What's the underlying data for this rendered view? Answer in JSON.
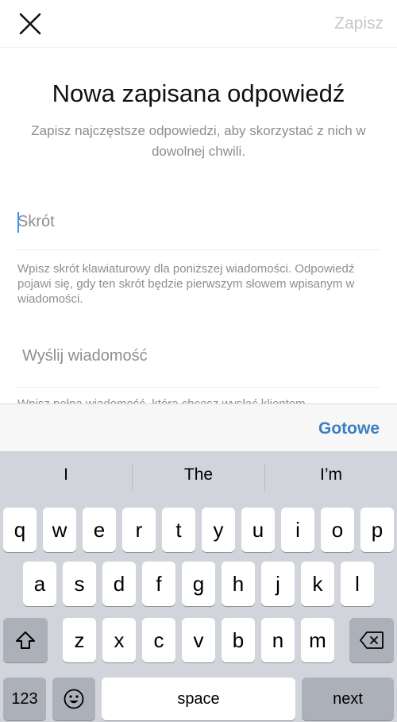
{
  "header": {
    "close_icon": "close-icon",
    "save_label": "Zapisz"
  },
  "main": {
    "title": "Nowa zapisana odpowiedź",
    "subtitle": "Zapisz najczęstsze odpowiedzi, aby skorzystać z nich w dowolnej chwili.",
    "shortcut": {
      "value": "",
      "placeholder": "Skrót"
    },
    "shortcut_hint": "Wpisz skrót klawiaturowy dla poniższej wiadomości. Odpowiedź pojawi się, gdy ten skrót będzie pierwszym słowem wpisanym w wiadomości.",
    "message": {
      "value": "",
      "placeholder": "Wyślij wiadomość"
    },
    "message_hint": "Wpisz pełną wiadomość, którą chcesz wysłać klientom"
  },
  "toolbar": {
    "done_label": "Gotowe"
  },
  "keyboard": {
    "suggestions": [
      "I",
      "The",
      "I’m"
    ],
    "row1": [
      "q",
      "w",
      "e",
      "r",
      "t",
      "y",
      "u",
      "i",
      "o",
      "p"
    ],
    "row2": [
      "a",
      "s",
      "d",
      "f",
      "g",
      "h",
      "j",
      "k",
      "l"
    ],
    "row3": [
      "z",
      "x",
      "c",
      "v",
      "b",
      "n",
      "m"
    ],
    "numbers_label": "123",
    "emoji_icon": "emoji-icon",
    "space_label": "space",
    "next_label": "next",
    "shift_icon": "shift-icon",
    "delete_icon": "backspace-icon"
  }
}
